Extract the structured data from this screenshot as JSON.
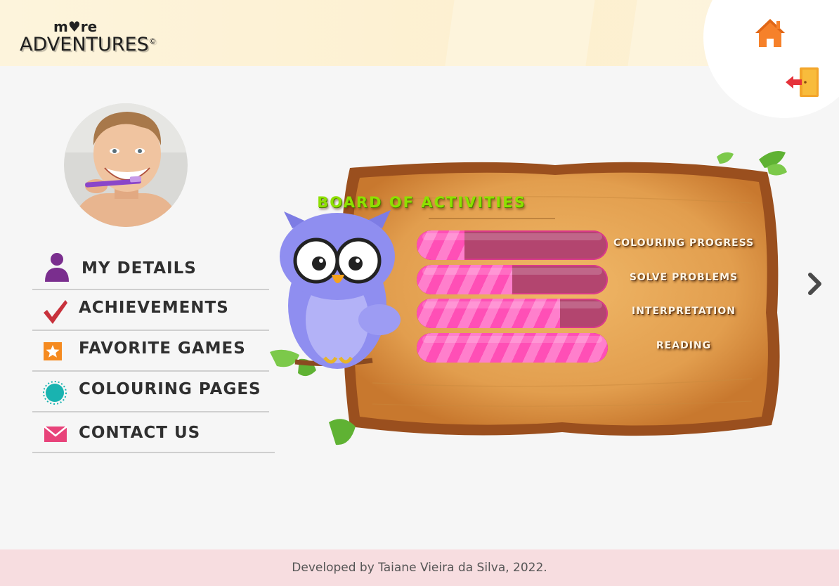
{
  "app": {
    "logo_top": "m♥re",
    "logo_main": "ADVENTURES",
    "logo_mark": "©"
  },
  "header": {
    "home_icon": "home-icon",
    "exit_icon": "exit-door-icon"
  },
  "profile": {
    "avatar": "child-photo-avatar"
  },
  "menu": {
    "items": [
      {
        "label": "MY DETAILS",
        "icon": "user-icon",
        "color": "#7a2e8e"
      },
      {
        "label": "ACHIEVEMENTS",
        "icon": "checkmark-icon",
        "color": "#c8323c"
      },
      {
        "label": "FAVORITE GAMES",
        "icon": "star-icon",
        "color": "#f58a1f"
      },
      {
        "label": "COLOURING PAGES",
        "icon": "sun-icon",
        "color": "#19b3b0"
      },
      {
        "label": "CONTACT US",
        "icon": "mail-icon",
        "color": "#e8437a"
      }
    ]
  },
  "board": {
    "title": "BOARD OF ACTIVITIES",
    "mascot": "owl-mascot",
    "activities": [
      {
        "label": "COLOURING PROGRESS",
        "progress": 0.25
      },
      {
        "label": "SOLVE PROBLEMS",
        "progress": 0.5
      },
      {
        "label": "INTERPRETATION",
        "progress": 0.75
      },
      {
        "label": "READING",
        "progress": 1.0
      }
    ]
  },
  "navigation": {
    "next_icon": "chevron-right-icon"
  },
  "footer": {
    "text": "Developed by Taiane Vieira da Silva, 2022."
  },
  "colors": {
    "header_bg": "#fdf4dc",
    "page_bg": "#f6f6f6",
    "footer_bg": "#f7dde0",
    "accent_pink": "#ff4fb6",
    "board_wood": "#e4a354",
    "title_green": "#8ee000"
  }
}
